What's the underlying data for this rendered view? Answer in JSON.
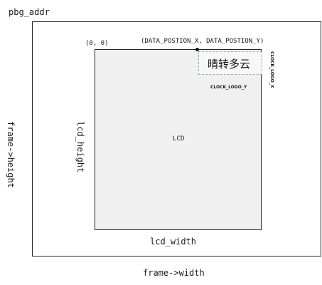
{
  "labels": {
    "pbg_addr": "pbg_addr",
    "origin": "(0, 0)",
    "data_position": "(DATA_POSTION_X, DATA_POSTION_Y)",
    "weather": "晴转多云",
    "clock_logo_y": "CLOCK_LOGO_Y",
    "clock_logo_x": "CLOCK_LOGO_X",
    "lcd": "LCD",
    "lcd_width": "lcd_width",
    "lcd_height": "lcd_height",
    "frame_width": "frame->width",
    "frame_height": "frame->height"
  }
}
